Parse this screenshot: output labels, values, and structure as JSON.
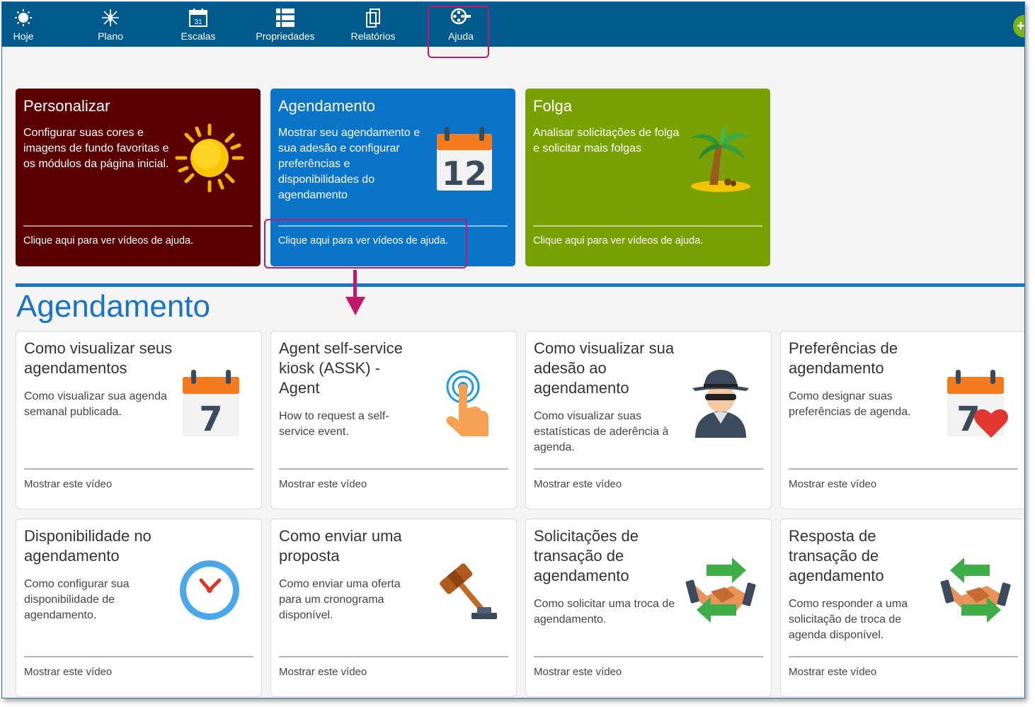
{
  "nav": {
    "items": [
      {
        "label": "Hoje",
        "icon": "sun-icon"
      },
      {
        "label": "Plano",
        "icon": "compass-icon"
      },
      {
        "label": "Escalas",
        "icon": "calendar-icon",
        "day": "31"
      },
      {
        "label": "Propriedades",
        "icon": "list-icon"
      },
      {
        "label": "Relatórios",
        "icon": "reports-icon"
      },
      {
        "label": "Ajuda",
        "icon": "film-reel-icon"
      }
    ],
    "add_button": "+-"
  },
  "tiles": [
    {
      "title": "Personalizar",
      "description": "Configurar suas cores e imagens de fundo favoritas e os módulos da página inicial.",
      "link": "Clique aqui para ver vídeos de ajuda.",
      "color": "#5b0000",
      "icon": "sun-icon"
    },
    {
      "title": "Agendamento",
      "description": "Mostrar seu agendamento e sua adesão e configurar preferências e disponibilidades do agendamento",
      "link": "Clique aqui para ver vídeos de ajuda.",
      "color": "#0a74c8",
      "icon": "calendar-icon",
      "day": "12"
    },
    {
      "title": "Folga",
      "description": "Analisar solicitações de folga e solicitar mais folgas",
      "link": "Clique aqui para ver vídeos de ajuda.",
      "color": "#79a104",
      "icon": "palm-tree-icon"
    }
  ],
  "section": {
    "title": "Agendamento"
  },
  "highlight_color": "#c2186b",
  "cards": [
    {
      "title": "Como visualizar seus agendamentos",
      "description": "Como visualizar sua agenda semanal publicada.",
      "link": "Mostrar este vídeo",
      "icon": "calendar-icon",
      "day": "7"
    },
    {
      "title": "Agent self-service kiosk (ASSK) - Agent",
      "description": "How to request a self-service event.",
      "link": "Mostrar este vídeo",
      "icon": "touch-hand-icon"
    },
    {
      "title": "Como visualizar sua adesão ao agendamento",
      "description": "Como visualizar suas estatísticas de aderência à agenda.",
      "link": "Mostrar este vídeo",
      "icon": "spy-icon"
    },
    {
      "title": "Preferências de agendamento",
      "description": "Como designar suas preferências de agenda.",
      "link": "Mostrar este vídeo",
      "icon": "calendar-heart-icon",
      "day": "7"
    },
    {
      "title": "Disponibilidade no agendamento",
      "description": "Como configurar sua disponibilidade de agendamento.",
      "link": "Mostrar este vídeo",
      "icon": "clock-icon"
    },
    {
      "title": "Como enviar uma proposta",
      "description": "Como enviar uma oferta para um cronograma disponível.",
      "link": "Mostrar este vídeo",
      "icon": "gavel-icon"
    },
    {
      "title": "Solicitações de transação de agendamento",
      "description": "Como solicitar uma troca de agendamento.",
      "link": "Mostrar este vídeo",
      "icon": "handshake-arrows-icon"
    },
    {
      "title": "Resposta de transação de agendamento",
      "description": "Como responder a uma solicitação de troca de agenda disponível.",
      "link": "Mostrar este vídeo",
      "icon": "handshake-arrows-icon"
    }
  ]
}
